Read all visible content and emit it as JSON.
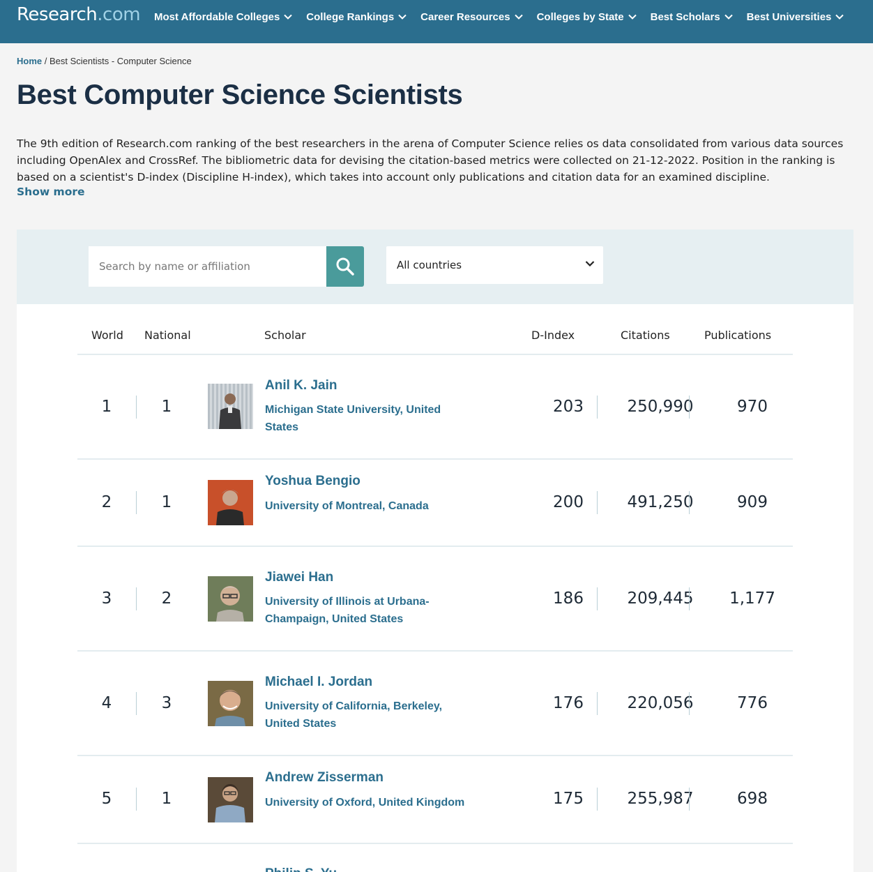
{
  "header": {
    "logo_main": "Research",
    "logo_suffix": ".com",
    "nav": [
      {
        "label": "Most Affordable Colleges"
      },
      {
        "label": "College Rankings"
      },
      {
        "label": "Career Resources"
      },
      {
        "label": "Colleges by State"
      },
      {
        "label": "Best Scholars"
      },
      {
        "label": "Best Universities"
      }
    ]
  },
  "breadcrumb": {
    "home": "Home",
    "separator": " / ",
    "current": "Best Scientists - Computer Science"
  },
  "page": {
    "title": "Best Computer Science Scientists",
    "intro": "The 9th edition of Research.com ranking of the best researchers in the arena of Computer Science relies os data consolidated from various data sources including OpenAlex and CrossRef. The bibliometric data for devising the citation-based metrics were collected on 21-12-2022. Position in the ranking is based on a scientist's D-index (Discipline H-index), which takes into account only publications and citation data for an examined discipline.",
    "show_more": "Show more"
  },
  "filters": {
    "search_placeholder": "Search by name or affiliation",
    "search_icon": "search-icon",
    "country_selected": "All countries"
  },
  "table": {
    "columns": {
      "world": "World",
      "national": "National",
      "scholar": "Scholar",
      "dindex": "D-Index",
      "citations": "Citations",
      "publications": "Publications"
    },
    "rows": [
      {
        "world": "1",
        "national": "1",
        "name": "Anil K. Jain",
        "affiliation": "Michigan State University, United States",
        "dindex": "203",
        "citations": "250,990",
        "publications": "970"
      },
      {
        "world": "2",
        "national": "1",
        "name": "Yoshua Bengio",
        "affiliation": "University of Montreal, Canada",
        "dindex": "200",
        "citations": "491,250",
        "publications": "909"
      },
      {
        "world": "3",
        "national": "2",
        "name": "Jiawei Han",
        "affiliation": "University of Illinois at Urbana-Champaign, United States",
        "dindex": "186",
        "citations": "209,445",
        "publications": "1,177"
      },
      {
        "world": "4",
        "national": "3",
        "name": "Michael I. Jordan",
        "affiliation": "University of California, Berkeley, United States",
        "dindex": "176",
        "citations": "220,056",
        "publications": "776"
      },
      {
        "world": "5",
        "national": "1",
        "name": "Andrew Zisserman",
        "affiliation": "University of Oxford, United Kingdom",
        "dindex": "175",
        "citations": "255,987",
        "publications": "698"
      },
      {
        "world": "",
        "national": "",
        "name": "Philip S. Yu",
        "affiliation": "",
        "dindex": "",
        "citations": "",
        "publications": ""
      }
    ]
  },
  "colors": {
    "header_bg": "#2b6e8e",
    "link": "#2b6e8e",
    "title": "#1b2f45",
    "search_button": "#4a9b9b",
    "filter_bg": "#e6eff2"
  }
}
